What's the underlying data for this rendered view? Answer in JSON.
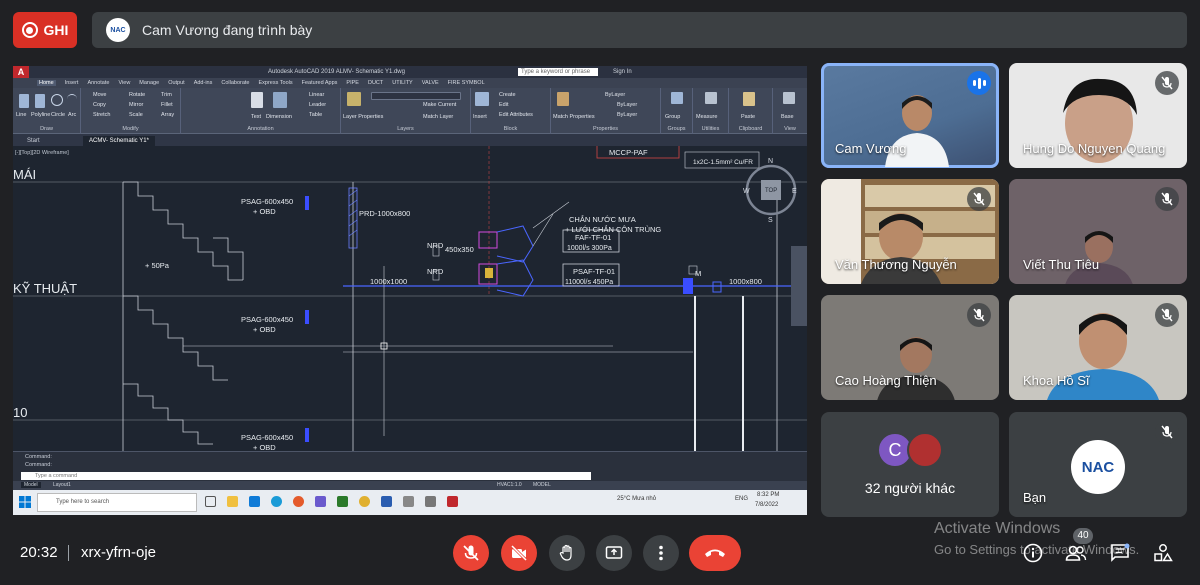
{
  "top_bar": {
    "record_label": "GHI",
    "presenter_text": "Cam Vương đang trình bày",
    "presenter_logo_text": "NAC"
  },
  "shared_screen": {
    "app_title": "Autodesk AutoCAD 2019   ALMV- Schematic Y1.dwg",
    "search_placeholder": "Type a keyword or phrase",
    "sign_in": "Sign In",
    "menu_tabs": [
      "Home",
      "Insert",
      "Annotate",
      "View",
      "Manage",
      "Output",
      "Add-ins",
      "Collaborate",
      "Express Tools",
      "Featured Apps",
      "PIPE",
      "DUCT",
      "UTILITY",
      "VALVE",
      "FIRE SYMBOL"
    ],
    "ribbon_groups": [
      {
        "label": "Draw",
        "items": [
          "Line",
          "Polyline",
          "Circle",
          "Arc"
        ]
      },
      {
        "label": "Modify",
        "items": [
          "Move",
          "Rotate",
          "Trim",
          "Copy",
          "Mirror",
          "Fillet",
          "Stretch",
          "Scale",
          "Array"
        ]
      },
      {
        "label": "Annotation",
        "items": [
          "Text",
          "Dimension",
          "Linear",
          "Leader",
          "Table"
        ]
      },
      {
        "label": "Layers",
        "items": [
          "Layer Properties",
          "Make Current",
          "Match Layer"
        ]
      },
      {
        "label": "Block",
        "items": [
          "Insert",
          "Create",
          "Edit",
          "Edit Attributes"
        ]
      },
      {
        "label": "Properties",
        "items": [
          "Match Properties",
          "ByLayer",
          "ByLayer",
          "ByLayer"
        ]
      },
      {
        "label": "Groups",
        "items": [
          "Group"
        ]
      },
      {
        "label": "Utilities",
        "items": [
          "Measure"
        ]
      },
      {
        "label": "Clipboard",
        "items": [
          "Paste"
        ]
      },
      {
        "label": "View",
        "items": [
          "Base"
        ]
      }
    ],
    "doc_tabs": [
      "Start",
      "ACMV- Schematic Y1*"
    ],
    "viewport_label": "[-][Top][2D Wireframe]",
    "drawing_labels": {
      "mai": "MÁI",
      "ky_thuat": "KỸ THUẬT",
      "level_10": "10",
      "psag_1": "PSAG-600x450",
      "obd_1": "+ OBD",
      "psag_2": "PSAG-600x450",
      "obd_2": "+ OBD",
      "psag_3": "PSAG-600x450",
      "obd_3": "+ OBD",
      "pressure": "+ 50Pa",
      "prd": "PRD-1000x800",
      "duct_1000": "1000x1000",
      "nrd_1": "NRD",
      "nrd_2": "NRD",
      "size_450": "450x350",
      "chan_nuoc": "CHẮN NƯỚC MƯA",
      "luoi_chan": "+ LƯỚI CHẮN CÔN TRÙNG",
      "faf": "FAF-TF-01",
      "faf_spec": "1000l/s    300Pa",
      "psaf": "PSAF-TF-01",
      "psaf_spec": "11000l/s  450Pa",
      "mccp": "MCCP-PAF",
      "cable": "1x2C-1.5mm² Cu/FR",
      "duct_1000x800": "1000x800",
      "m_label": "M",
      "compass_n": "N",
      "compass_s": "S",
      "compass_e": "E",
      "compass_w": "W",
      "compass_top": "TOP"
    },
    "command_lines": [
      "Command:",
      "Command:"
    ],
    "command_placeholder": "Type a command",
    "status_tabs": [
      "Model",
      "Layout1"
    ],
    "status_right": [
      "HVAC1:1.0",
      "MODEL"
    ],
    "taskbar_search": "Type here to search",
    "tray_weather": "25°C  Mưa nhỏ",
    "tray_lang": "ENG",
    "tray_time": "8:32 PM",
    "tray_date": "7/8/2022"
  },
  "participants": [
    {
      "name": "Cam Vương",
      "speaking": true
    },
    {
      "name": "Hung Do Nguyen Quang",
      "muted": true
    },
    {
      "name": "Văn Thương Nguyễn",
      "muted": true
    },
    {
      "name": "Viết Thu Tiêu",
      "muted": true
    },
    {
      "name": "Cao Hoàng Thiện",
      "muted": true
    },
    {
      "name": "Khoa Hồ Sĩ",
      "muted": true
    }
  ],
  "others_tile": {
    "avatar_letter": "C",
    "label": "32 người khác"
  },
  "self_tile": {
    "name": "Bạn",
    "logo_text": "NAC"
  },
  "bottom_bar": {
    "time": "20:32",
    "meeting_code": "xrx-yfrn-oje",
    "people_count": "40"
  },
  "windows_watermark": {
    "line1": "Activate Windows",
    "line2": "Go to Settings to activate Windows."
  },
  "colors": {
    "background": "#202124",
    "tile": "#3c4043",
    "danger": "#ea4335",
    "accent": "#8ab4f8",
    "speaking": "#1a73e8"
  }
}
